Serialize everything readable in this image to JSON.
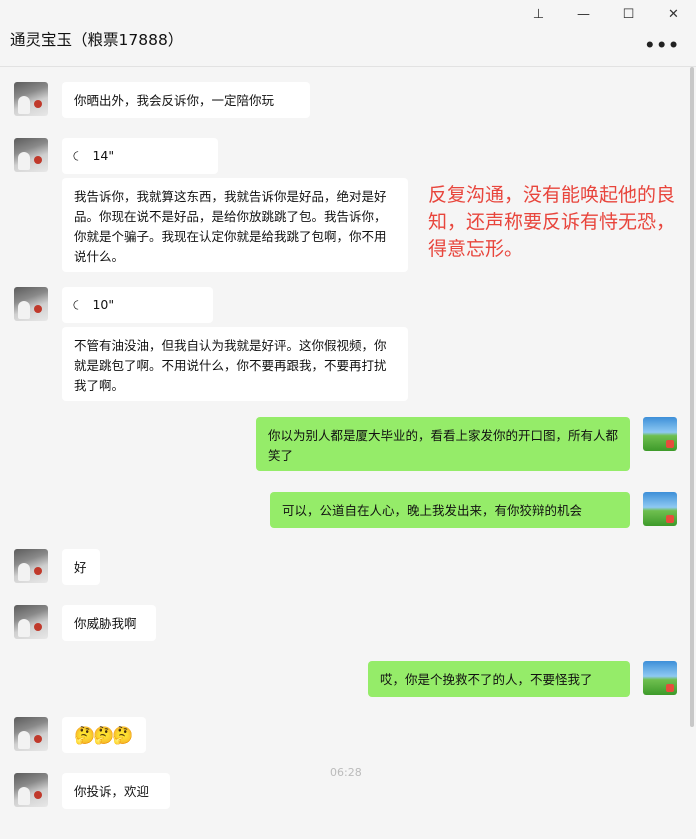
{
  "window": {
    "pin_icon": "pin-icon",
    "minimize_icon": "minimize-icon",
    "maximize_icon": "maximize-icon",
    "close_icon": "close-icon"
  },
  "header": {
    "title": "通灵宝玉（粮票17888）",
    "more_label": "•••"
  },
  "annotation": "反复沟通，没有能唤起他的良知，还声称要反诉有恃无恐，得意忘形。",
  "messages": [
    {
      "side": "left",
      "text": "你晒出外，我会反诉你，一定陪你玩"
    },
    {
      "side": "left",
      "type": "voice",
      "text": "14\""
    },
    {
      "side": "left",
      "text": "我告诉你，我就算这东西，我就告诉你是好品，绝对是好品。你现在说不是好品，是给你放跳跳了包。我告诉你，你就是个骗子。我现在认定你就是给我跳了包啊，你不用说什么。"
    },
    {
      "side": "left",
      "type": "voice",
      "text": "10\""
    },
    {
      "side": "left",
      "text": "不管有油没油，但我自认为我就是好评。这你假视频，你就是跳包了啊。不用说什么，你不要再跟我，不要再打扰我了啊。"
    },
    {
      "side": "right",
      "text": "你以为别人都是厦大毕业的，看看上家发你的开口图，所有人都笑了"
    },
    {
      "side": "right",
      "text": "可以，公道自在人心，晚上我发出来，有你狡辩的机会"
    },
    {
      "side": "left",
      "text": "好"
    },
    {
      "side": "left",
      "text": "你威胁我啊"
    },
    {
      "side": "right",
      "text": "哎，你是个挽救不了的人，不要怪我了"
    },
    {
      "side": "left",
      "text": "🤔🤔🤔"
    },
    {
      "side": "left",
      "text": "你投诉，欢迎"
    }
  ],
  "timestamp": "06:28"
}
